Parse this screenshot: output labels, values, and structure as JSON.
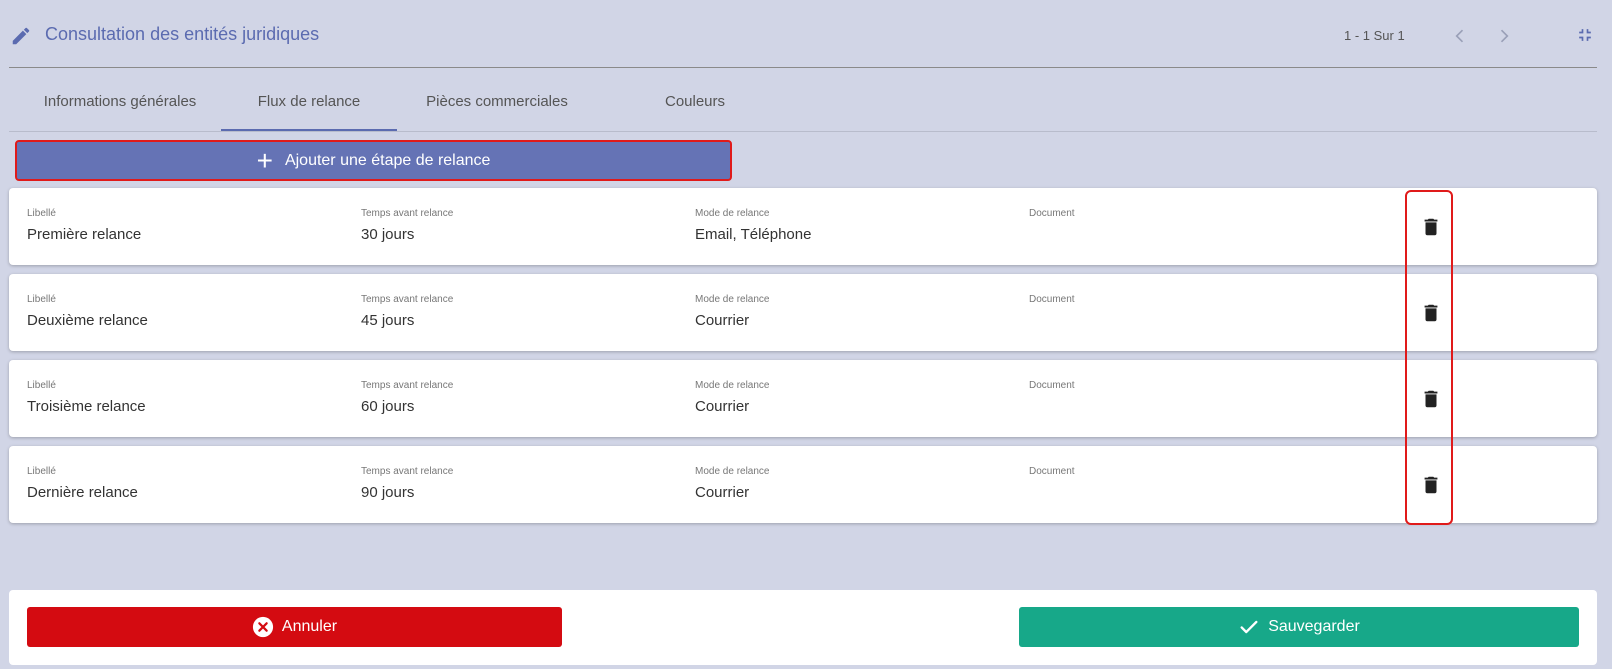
{
  "header": {
    "title": "Consultation des entités juridiques",
    "pager": "1 - 1 Sur 1"
  },
  "tabs": [
    {
      "label": "Informations générales"
    },
    {
      "label": "Flux de relance"
    },
    {
      "label": "Pièces commerciales"
    },
    {
      "label": "Couleurs"
    }
  ],
  "active_tab": "Flux de relance",
  "add_button": {
    "label": "Ajouter une étape de relance"
  },
  "columns": {
    "libelle": "Libellé",
    "temps": "Temps avant relance",
    "mode": "Mode de relance",
    "document": "Document"
  },
  "rows": [
    {
      "libelle": "Première relance",
      "temps": "30 jours",
      "mode": "Email, Téléphone",
      "document": ""
    },
    {
      "libelle": "Deuxième relance",
      "temps": "45 jours",
      "mode": "Courrier",
      "document": ""
    },
    {
      "libelle": "Troisième relance",
      "temps": "60 jours",
      "mode": "Courrier",
      "document": ""
    },
    {
      "libelle": "Dernière relance",
      "temps": "90 jours",
      "mode": "Courrier",
      "document": ""
    }
  ],
  "footer": {
    "cancel_label": "Annuler",
    "save_label": "Sauvegarder"
  },
  "colors": {
    "background": "#d1d5e6",
    "accent": "#5b6bb0",
    "add_button": "#6573b5",
    "cancel": "#d40b11",
    "save": "#17a889",
    "highlight": "#e01a1a"
  },
  "icons": {
    "edit": "pencil-icon",
    "prev": "chevron-left-icon",
    "next": "chevron-right-icon",
    "collapse": "collapse-icon",
    "add": "plus-icon",
    "delete": "trash-icon",
    "cancel": "close-circle-icon",
    "save": "check-icon"
  }
}
